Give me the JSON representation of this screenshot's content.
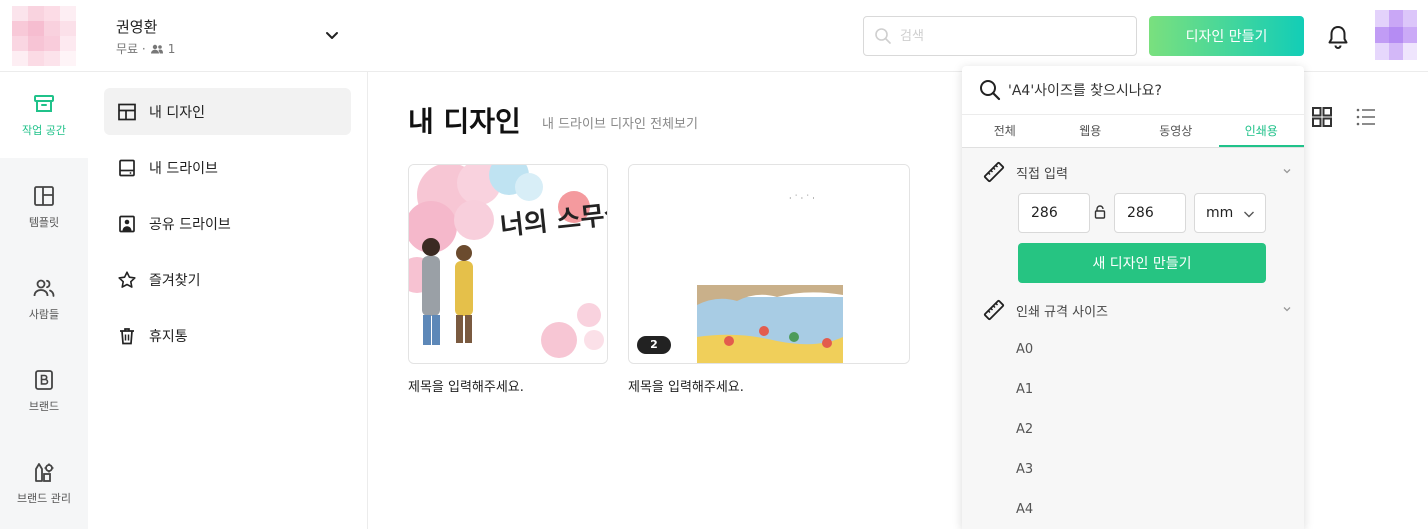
{
  "header": {
    "user_name": "권영환",
    "plan_label": "무료 ·",
    "member_count": "1",
    "search_placeholder": "검색",
    "create_button": "디자인 만들기"
  },
  "rail": {
    "items": [
      {
        "label": "작업 공간",
        "icon": "archive-box-icon",
        "active": true
      },
      {
        "label": "템플릿",
        "icon": "layout-template-icon"
      },
      {
        "label": "사람들",
        "icon": "people-icon"
      },
      {
        "label": "브랜드",
        "icon": "brand-b-icon"
      },
      {
        "label": "브랜드 관리",
        "icon": "brand-manage-icon"
      }
    ]
  },
  "sidenav": {
    "items": [
      {
        "label": "내 디자인",
        "icon": "layout-icon",
        "active": true
      },
      {
        "label": "내 드라이브",
        "icon": "drive-icon"
      },
      {
        "label": "공유 드라이브",
        "icon": "shared-drive-icon"
      },
      {
        "label": "즐겨찾기",
        "icon": "star-icon"
      },
      {
        "label": "휴지통",
        "icon": "trash-icon"
      }
    ]
  },
  "main": {
    "title": "내 디자인",
    "subtitle": "내 드라이브 디자인 전체보기",
    "designs": [
      {
        "title": "제목을 입력해주세요.",
        "thumbnail": "cherry-blossom-couple-illustration",
        "thumb_text": "너의 스무살을"
      },
      {
        "title": "제목을 입력해주세요.",
        "thumbnail": "riverside-picnic-illustration",
        "page_count": "2"
      }
    ]
  },
  "popup": {
    "search_text": "'A4'사이즈를 찾으시나요?",
    "tabs": [
      "전체",
      "웹용",
      "동영상",
      "인쇄용"
    ],
    "active_tab": "인쇄용",
    "custom_section": "직접 입력",
    "width_value": "286",
    "height_value": "286",
    "unit": "mm",
    "new_design_button": "새 디자인 만들기",
    "print_section": "인쇄 규격 사이즈",
    "sizes": [
      "A0",
      "A1",
      "A2",
      "A3",
      "A4"
    ]
  },
  "colors": {
    "accent": "#20c28a",
    "button_gradient_start": "#7ae07e",
    "button_gradient_end": "#12cdb7",
    "popup_bg": "#f7f7f7"
  }
}
